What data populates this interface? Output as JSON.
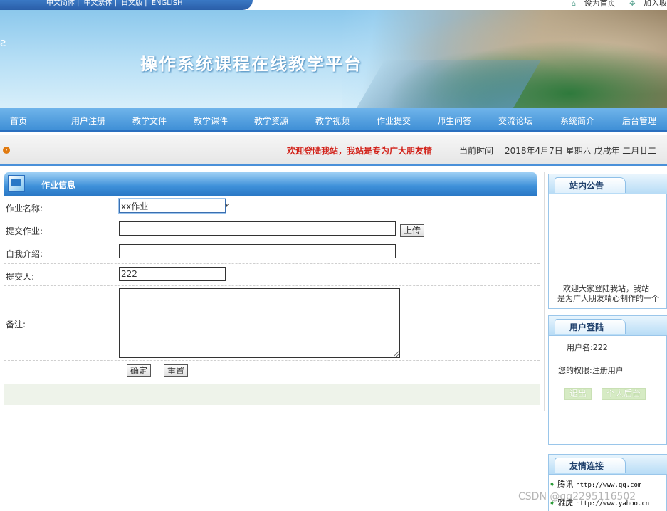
{
  "lang_links": [
    "中文简体",
    "中文繁体",
    "日文版",
    "ENGLISH"
  ],
  "top_links": {
    "set_home": "设为首页",
    "add_favorite": "加入收"
  },
  "banner": {
    "title": "操作系统课程在线教学平台"
  },
  "nav": [
    "首页",
    "用户注册",
    "教学文件",
    "教学课件",
    "教学资源",
    "教学视频",
    "作业提交",
    "师生问答",
    "交流论坛",
    "系统简介",
    "后台管理"
  ],
  "info_bar": {
    "marquee": "欢迎登陆我站，我站是专为广大朋友精",
    "time_label": "当前时间",
    "time_value": "2018年4月7日 星期六 戊戌年 二月廿二"
  },
  "main": {
    "title": "作业信息",
    "fields": {
      "name_label": "作业名称:",
      "name_value": "xx作业",
      "required_mark": "*",
      "submit_label": "提交作业:",
      "upload_button": "上传",
      "intro_label": "自我介绍:",
      "submitter_label": "提交人:",
      "submitter_value": "222",
      "remark_label": "备注:"
    },
    "buttons": {
      "confirm": "确定",
      "reset": "重置"
    }
  },
  "sidebar": {
    "notice": {
      "title": "站内公告",
      "text_line1": "欢迎大家登陆我站，我站",
      "text_line2": "是为广大朋友精心制作的一个"
    },
    "login": {
      "title": "用户登陆",
      "username": "用户名:222",
      "role": "您的权限:注册用户",
      "logout": "退出",
      "personal": "个人后台"
    },
    "friends": {
      "title": "友情连接",
      "links": [
        {
          "name": "腾讯",
          "url": "http://www.qq.com"
        },
        {
          "name": "雅虎",
          "url": "http://www.yahoo.cn"
        }
      ]
    }
  },
  "watermark": "CSDN @qq2295116502"
}
